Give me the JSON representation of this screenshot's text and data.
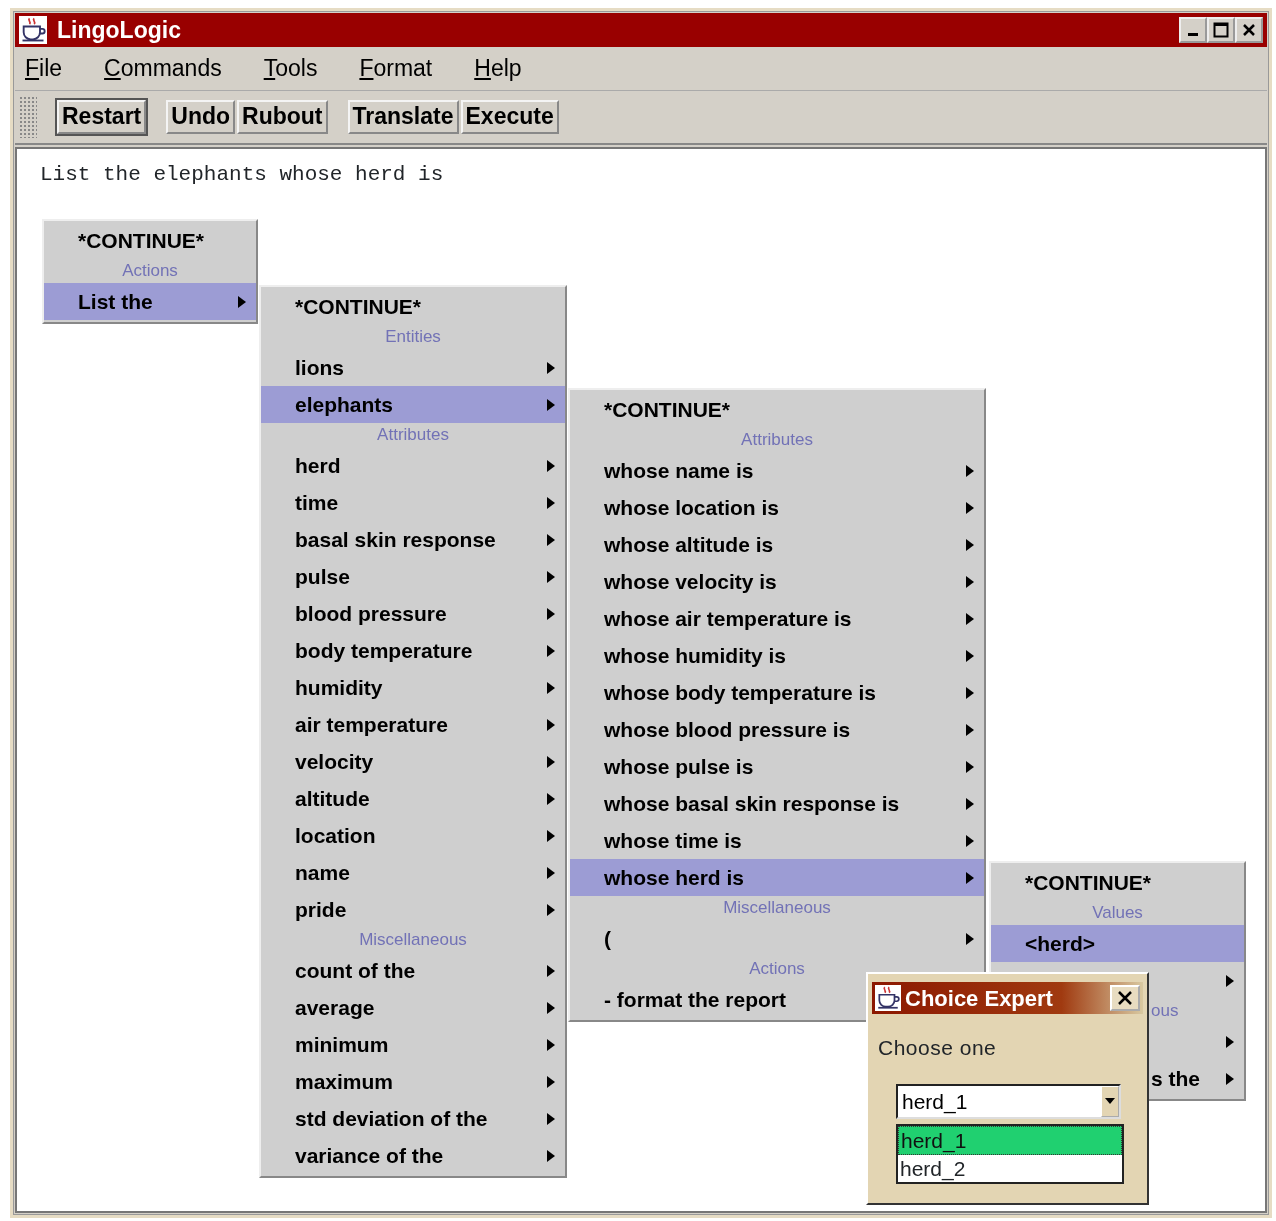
{
  "window": {
    "title": "LingoLogic"
  },
  "menubar": [
    {
      "label": "File"
    },
    {
      "label": "Commands"
    },
    {
      "label": "Tools"
    },
    {
      "label": "Format"
    },
    {
      "label": "Help"
    }
  ],
  "toolbar": [
    [
      {
        "label": "Restart",
        "focused": true
      }
    ],
    [
      {
        "label": "Undo",
        "focused": false
      },
      {
        "label": "Rubout",
        "focused": false
      }
    ],
    [
      {
        "label": "Translate",
        "focused": false
      },
      {
        "label": "Execute",
        "focused": false
      }
    ]
  ],
  "editor": {
    "text": "List the elephants whose herd is"
  },
  "menus": [
    {
      "rows": [
        {
          "kind": "continue",
          "label": "*CONTINUE*",
          "selected": false
        },
        {
          "kind": "header",
          "label": "Actions"
        },
        {
          "kind": "item",
          "label": "List the",
          "submenu": true,
          "selected": true
        }
      ]
    },
    {
      "rows": [
        {
          "kind": "continue",
          "label": "*CONTINUE*",
          "selected": false
        },
        {
          "kind": "header",
          "label": "Entities"
        },
        {
          "kind": "item",
          "label": "lions",
          "submenu": true,
          "selected": false
        },
        {
          "kind": "item",
          "label": "elephants",
          "submenu": true,
          "selected": true
        },
        {
          "kind": "header",
          "label": "Attributes"
        },
        {
          "kind": "item",
          "label": "herd",
          "submenu": true,
          "selected": false
        },
        {
          "kind": "item",
          "label": "time",
          "submenu": true,
          "selected": false
        },
        {
          "kind": "item",
          "label": "basal skin response",
          "submenu": true,
          "selected": false
        },
        {
          "kind": "item",
          "label": "pulse",
          "submenu": true,
          "selected": false
        },
        {
          "kind": "item",
          "label": "blood pressure",
          "submenu": true,
          "selected": false
        },
        {
          "kind": "item",
          "label": "body temperature",
          "submenu": true,
          "selected": false
        },
        {
          "kind": "item",
          "label": "humidity",
          "submenu": true,
          "selected": false
        },
        {
          "kind": "item",
          "label": "air temperature",
          "submenu": true,
          "selected": false
        },
        {
          "kind": "item",
          "label": "velocity",
          "submenu": true,
          "selected": false
        },
        {
          "kind": "item",
          "label": "altitude",
          "submenu": true,
          "selected": false
        },
        {
          "kind": "item",
          "label": "location",
          "submenu": true,
          "selected": false
        },
        {
          "kind": "item",
          "label": "name",
          "submenu": true,
          "selected": false
        },
        {
          "kind": "item",
          "label": "pride",
          "submenu": true,
          "selected": false
        },
        {
          "kind": "header",
          "label": "Miscellaneous"
        },
        {
          "kind": "item",
          "label": "count of the",
          "submenu": true,
          "selected": false
        },
        {
          "kind": "item",
          "label": "average",
          "submenu": true,
          "selected": false
        },
        {
          "kind": "item",
          "label": "minimum",
          "submenu": true,
          "selected": false
        },
        {
          "kind": "item",
          "label": "maximum",
          "submenu": true,
          "selected": false
        },
        {
          "kind": "item",
          "label": "std deviation of the",
          "submenu": true,
          "selected": false
        },
        {
          "kind": "item",
          "label": "variance of the",
          "submenu": true,
          "selected": false
        }
      ]
    },
    {
      "rows": [
        {
          "kind": "continue",
          "label": "*CONTINUE*",
          "selected": false
        },
        {
          "kind": "header",
          "label": "Attributes"
        },
        {
          "kind": "item",
          "label": "whose name is",
          "submenu": true,
          "selected": false
        },
        {
          "kind": "item",
          "label": "whose location is",
          "submenu": true,
          "selected": false
        },
        {
          "kind": "item",
          "label": "whose altitude is",
          "submenu": true,
          "selected": false
        },
        {
          "kind": "item",
          "label": "whose velocity is",
          "submenu": true,
          "selected": false
        },
        {
          "kind": "item",
          "label": "whose air temperature is",
          "submenu": true,
          "selected": false
        },
        {
          "kind": "item",
          "label": "whose humidity is",
          "submenu": true,
          "selected": false
        },
        {
          "kind": "item",
          "label": "whose body temperature is",
          "submenu": true,
          "selected": false
        },
        {
          "kind": "item",
          "label": "whose blood pressure is",
          "submenu": true,
          "selected": false
        },
        {
          "kind": "item",
          "label": "whose pulse is",
          "submenu": true,
          "selected": false
        },
        {
          "kind": "item",
          "label": "whose basal skin response is",
          "submenu": true,
          "selected": false
        },
        {
          "kind": "item",
          "label": "whose time is",
          "submenu": true,
          "selected": false
        },
        {
          "kind": "item",
          "label": "whose herd is",
          "submenu": true,
          "selected": true
        },
        {
          "kind": "header",
          "label": "Miscellaneous"
        },
        {
          "kind": "item",
          "label": "(",
          "submenu": true,
          "selected": false
        },
        {
          "kind": "header",
          "label": "Actions"
        },
        {
          "kind": "item",
          "label": "- format the report",
          "submenu": false,
          "selected": false
        }
      ]
    },
    {
      "rows": [
        {
          "kind": "continue",
          "label": "*CONTINUE*",
          "selected": false
        },
        {
          "kind": "header",
          "label": "Values"
        },
        {
          "kind": "item",
          "label": "<herd>",
          "submenu": false,
          "selected": true
        },
        {
          "kind": "item",
          "submenu": true,
          "selected": false,
          "covered": true
        },
        {
          "kind": "header",
          "label": "ous",
          "covered": true
        },
        {
          "kind": "item",
          "submenu": true,
          "selected": false,
          "covered": true
        },
        {
          "kind": "item",
          "label": "s the",
          "submenu": true,
          "selected": false,
          "covered": true
        }
      ]
    }
  ],
  "dialog": {
    "title": "Choice Expert",
    "prompt": "Choose one",
    "value": "herd_1",
    "options": [
      {
        "label": "herd_1",
        "selected": true
      },
      {
        "label": "herd_2",
        "selected": false
      }
    ]
  }
}
